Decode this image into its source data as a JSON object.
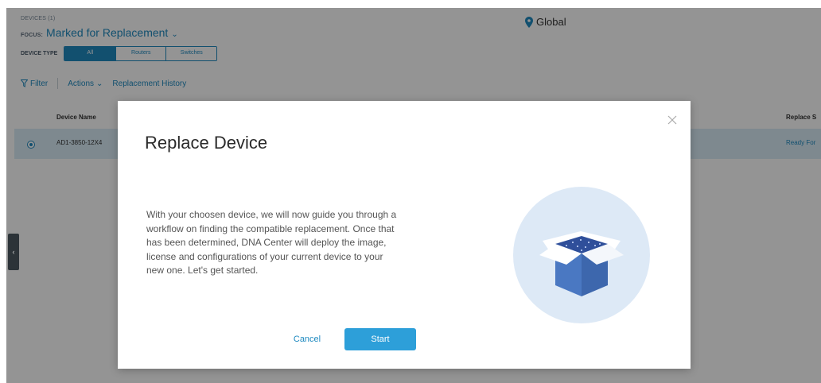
{
  "header": {
    "devices_count": "DEVICES (1)",
    "focus_label": "FOCUS:",
    "focus_value": "Marked for Replacement",
    "location": "Global"
  },
  "device_type": {
    "label": "DEVICE TYPE",
    "options": [
      "All",
      "Routers",
      "Switches"
    ],
    "selected": "All"
  },
  "toolbar": {
    "filter": "Filter",
    "actions": "Actions",
    "history": "Replacement History"
  },
  "table": {
    "headers": {
      "device_name": "Device Name",
      "replace_status": "Replace S"
    },
    "rows": [
      {
        "device_name": "AD1-3850-12X4",
        "status": "Ready For"
      }
    ]
  },
  "modal": {
    "title": "Replace Device",
    "body": "With your choosen device, we will now guide you through a workflow on finding the compatible replacement. Once that has been determined, DNA Center will deploy the image, license and configurations of your current device to your new one. Let's get started.",
    "cancel_label": "Cancel",
    "start_label": "Start"
  },
  "colors": {
    "accent": "#1f8ac0",
    "button": "#2d9fd9",
    "selected_row": "#d9ecf7",
    "overlay": "#000000"
  },
  "icons": [
    "location-pin-icon",
    "filter-icon",
    "chevron-down-icon",
    "close-icon",
    "open-box-illustration",
    "collapse-arrow-icon"
  ]
}
